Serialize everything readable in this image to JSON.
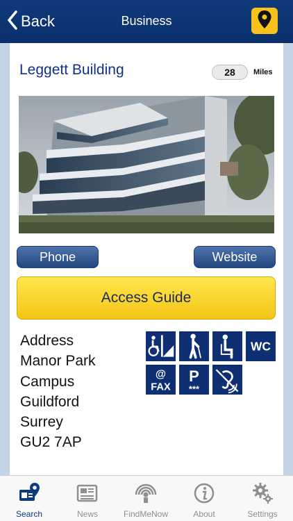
{
  "nav": {
    "back_label": "Back",
    "title": "Business",
    "location_icon": "map-pin-icon"
  },
  "business": {
    "name": "Leggett Building",
    "distance": "28",
    "distance_unit": "Miles"
  },
  "actions": {
    "phone_label": "Phone",
    "website_label": "Website",
    "access_guide_label": "Access Guide"
  },
  "address": {
    "lines": [
      "Address",
      "Manor Park",
      "Campus",
      "Guildford",
      "Surrey",
      "GU2 7AP"
    ]
  },
  "accessibility_icons": [
    "wheelchair-ramp-icon",
    "walking-cane-icon",
    "seated-person-icon",
    "wc-icon",
    "email-fax-icon",
    "accessible-parking-icon",
    "hearing-loop-icon"
  ],
  "accessibility_text": {
    "wc": "WC",
    "email": "@",
    "fax": "FAX",
    "parking": "P",
    "parking_stars": "***"
  },
  "tabs": [
    {
      "label": "Search",
      "icon": "search-map-icon",
      "active": true
    },
    {
      "label": "News",
      "icon": "newspaper-icon",
      "active": false
    },
    {
      "label": "FindMeNow",
      "icon": "find-me-now-icon",
      "active": false
    },
    {
      "label": "About",
      "icon": "info-icon",
      "active": false
    },
    {
      "label": "Settings",
      "icon": "gear-icon",
      "active": false
    }
  ],
  "colors": {
    "nav_bar": "#0f3a7c",
    "accent_yellow": "#f6c21b",
    "icon_tile": "#0e2f74",
    "title_blue": "#122f8e"
  }
}
